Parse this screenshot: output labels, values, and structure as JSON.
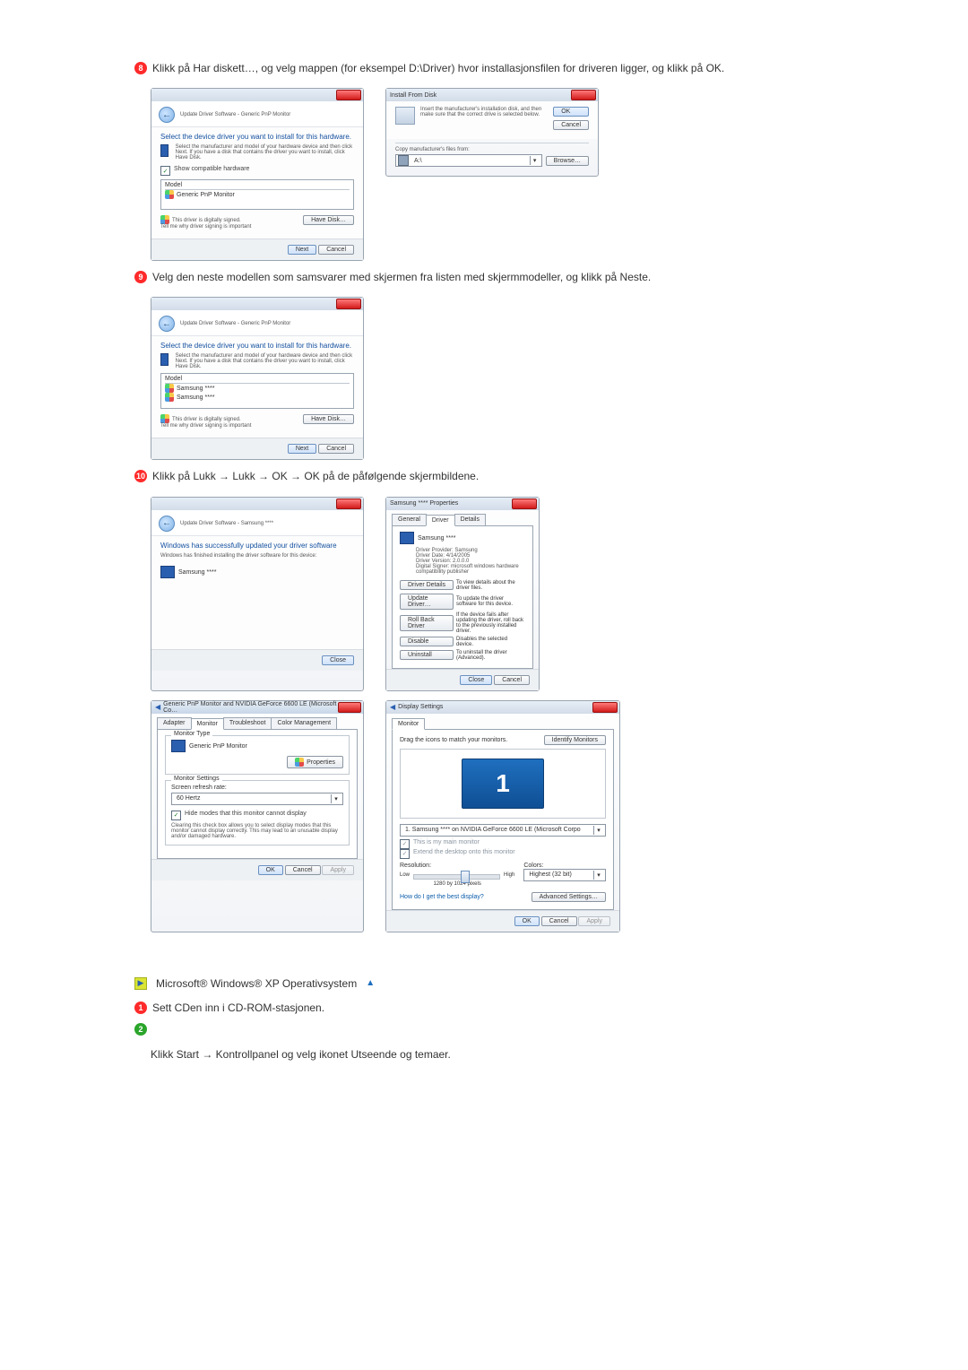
{
  "step8": {
    "num": "8",
    "text": "Klikk på Har diskett…, og velg mappen (for eksempel D:\\Driver) hvor installasjonsfilen for driveren ligger, og klikk på OK."
  },
  "wizard_select": {
    "crumb": "Update Driver Software - Generic PnP Monitor",
    "heading": "Select the device driver you want to install for this hardware.",
    "sub": "Select the manufacturer and model of your hardware device and then click Next. If you have a disk that contains the driver you want to install, click Have Disk.",
    "show_compat": "Show compatible hardware",
    "model_col": "Model",
    "model_item": "Generic PnP Monitor",
    "signed": "This driver is digitally signed.",
    "tell_why": "Tell me why driver signing is important",
    "have_disk": "Have Disk…",
    "next": "Next",
    "cancel": "Cancel"
  },
  "install_from_disk": {
    "title": "Install From Disk",
    "msg": "Insert the manufacturer's installation disk, and then make sure that the correct drive is selected below.",
    "ok": "OK",
    "cancel": "Cancel",
    "copy_from": "Copy manufacturer's files from:",
    "path": "A:\\",
    "browse": "Browse…"
  },
  "step9": {
    "num": "9",
    "text": "Velg den neste modellen som samsvarer med skjermen fra listen med skjermmodeller, og klikk på Neste."
  },
  "wizard_model_list": {
    "crumb": "Update Driver Software - Generic PnP Monitor",
    "heading": "Select the device driver you want to install for this hardware.",
    "model_col": "Model",
    "item1": "Samsung ****",
    "item2": "Samsung ****",
    "signed": "This driver is digitally signed.",
    "tell_why": "Tell me why driver signing is important",
    "have_disk": "Have Disk…",
    "next": "Next",
    "cancel": "Cancel"
  },
  "step10": {
    "num": "10",
    "text": "Klikk på Lukk → Lukk → OK → OK på de påfølgende skjermbildene."
  },
  "wizard_done": {
    "crumb": "Update Driver Software - Samsung ****",
    "heading": "Windows has successfully updated your driver software",
    "sub": "Windows has finished installing the driver software for this device:",
    "device": "Samsung ****",
    "close": "Close"
  },
  "driver_tab": {
    "title": "Samsung **** Properties",
    "tabs": {
      "general": "General",
      "driver": "Driver",
      "details": "Details"
    },
    "device": "Samsung ****",
    "rows": {
      "provider_l": "Driver Provider:",
      "provider_v": "Samsung",
      "date_l": "Driver Date:",
      "date_v": "4/14/2005",
      "version_l": "Driver Version:",
      "version_v": "2.0.0.0",
      "signer_l": "Digital Signer:",
      "signer_v": "microsoft windows hardware compatibility publisher"
    },
    "btns": {
      "details": "Driver Details",
      "details_d": "To view details about the driver files.",
      "update": "Update Driver…",
      "update_d": "To update the driver software for this device.",
      "rollback": "Roll Back Driver",
      "rollback_d": "If the device fails after updating the driver, roll back to the previously installed driver.",
      "disable": "Disable",
      "disable_d": "Disables the selected device.",
      "uninstall": "Uninstall",
      "uninstall_d": "To uninstall the driver (Advanced)."
    },
    "close": "Close",
    "cancel": "Cancel"
  },
  "monitor_props": {
    "title": "Generic PnP Monitor and NVIDIA GeForce 6600 LE (Microsoft Co…",
    "tabs": {
      "adapter": "Adapter",
      "monitor": "Monitor",
      "troubleshoot": "Troubleshoot",
      "cm": "Color Management"
    },
    "type_legend": "Monitor Type",
    "type_val": "Generic PnP Monitor",
    "properties": "Properties",
    "settings_legend": "Monitor Settings",
    "refresh_label": "Screen refresh rate:",
    "refresh_val": "60 Hertz",
    "hide_modes": "Hide modes that this monitor cannot display",
    "hide_desc": "Clearing this check box allows you to select display modes that this monitor cannot display correctly. This may lead to an unusable display and/or damaged hardware.",
    "ok": "OK",
    "cancel": "Cancel",
    "apply": "Apply"
  },
  "display_settings": {
    "title": "Display Settings",
    "tab": "Monitor",
    "drag": "Drag the icons to match your monitors.",
    "identify": "Identify Monitors",
    "mon_num": "1",
    "selector": "1. Samsung **** on NVIDIA GeForce 6600 LE (Microsoft Corpo",
    "main": "This is my main monitor",
    "extend": "Extend the desktop onto this monitor",
    "res_label": "Resolution:",
    "low": "Low",
    "high": "High",
    "res_val": "1280 by 1024 pixels",
    "colors_label": "Colors:",
    "colors_val": "Highest (32 bit)",
    "help": "How do I get the best display?",
    "adv": "Advanced Settings…",
    "ok": "OK",
    "cancel": "Cancel",
    "apply": "Apply"
  },
  "xp": {
    "heading": "Microsoft® Windows® XP Operativsystem",
    "step1_num": "1",
    "step1": "Sett CDen inn i CD-ROM-stasjonen.",
    "step2_num": "2",
    "step2_text": "Klikk Start → Kontrollpanel og velg ikonet Utseende og temaer."
  }
}
